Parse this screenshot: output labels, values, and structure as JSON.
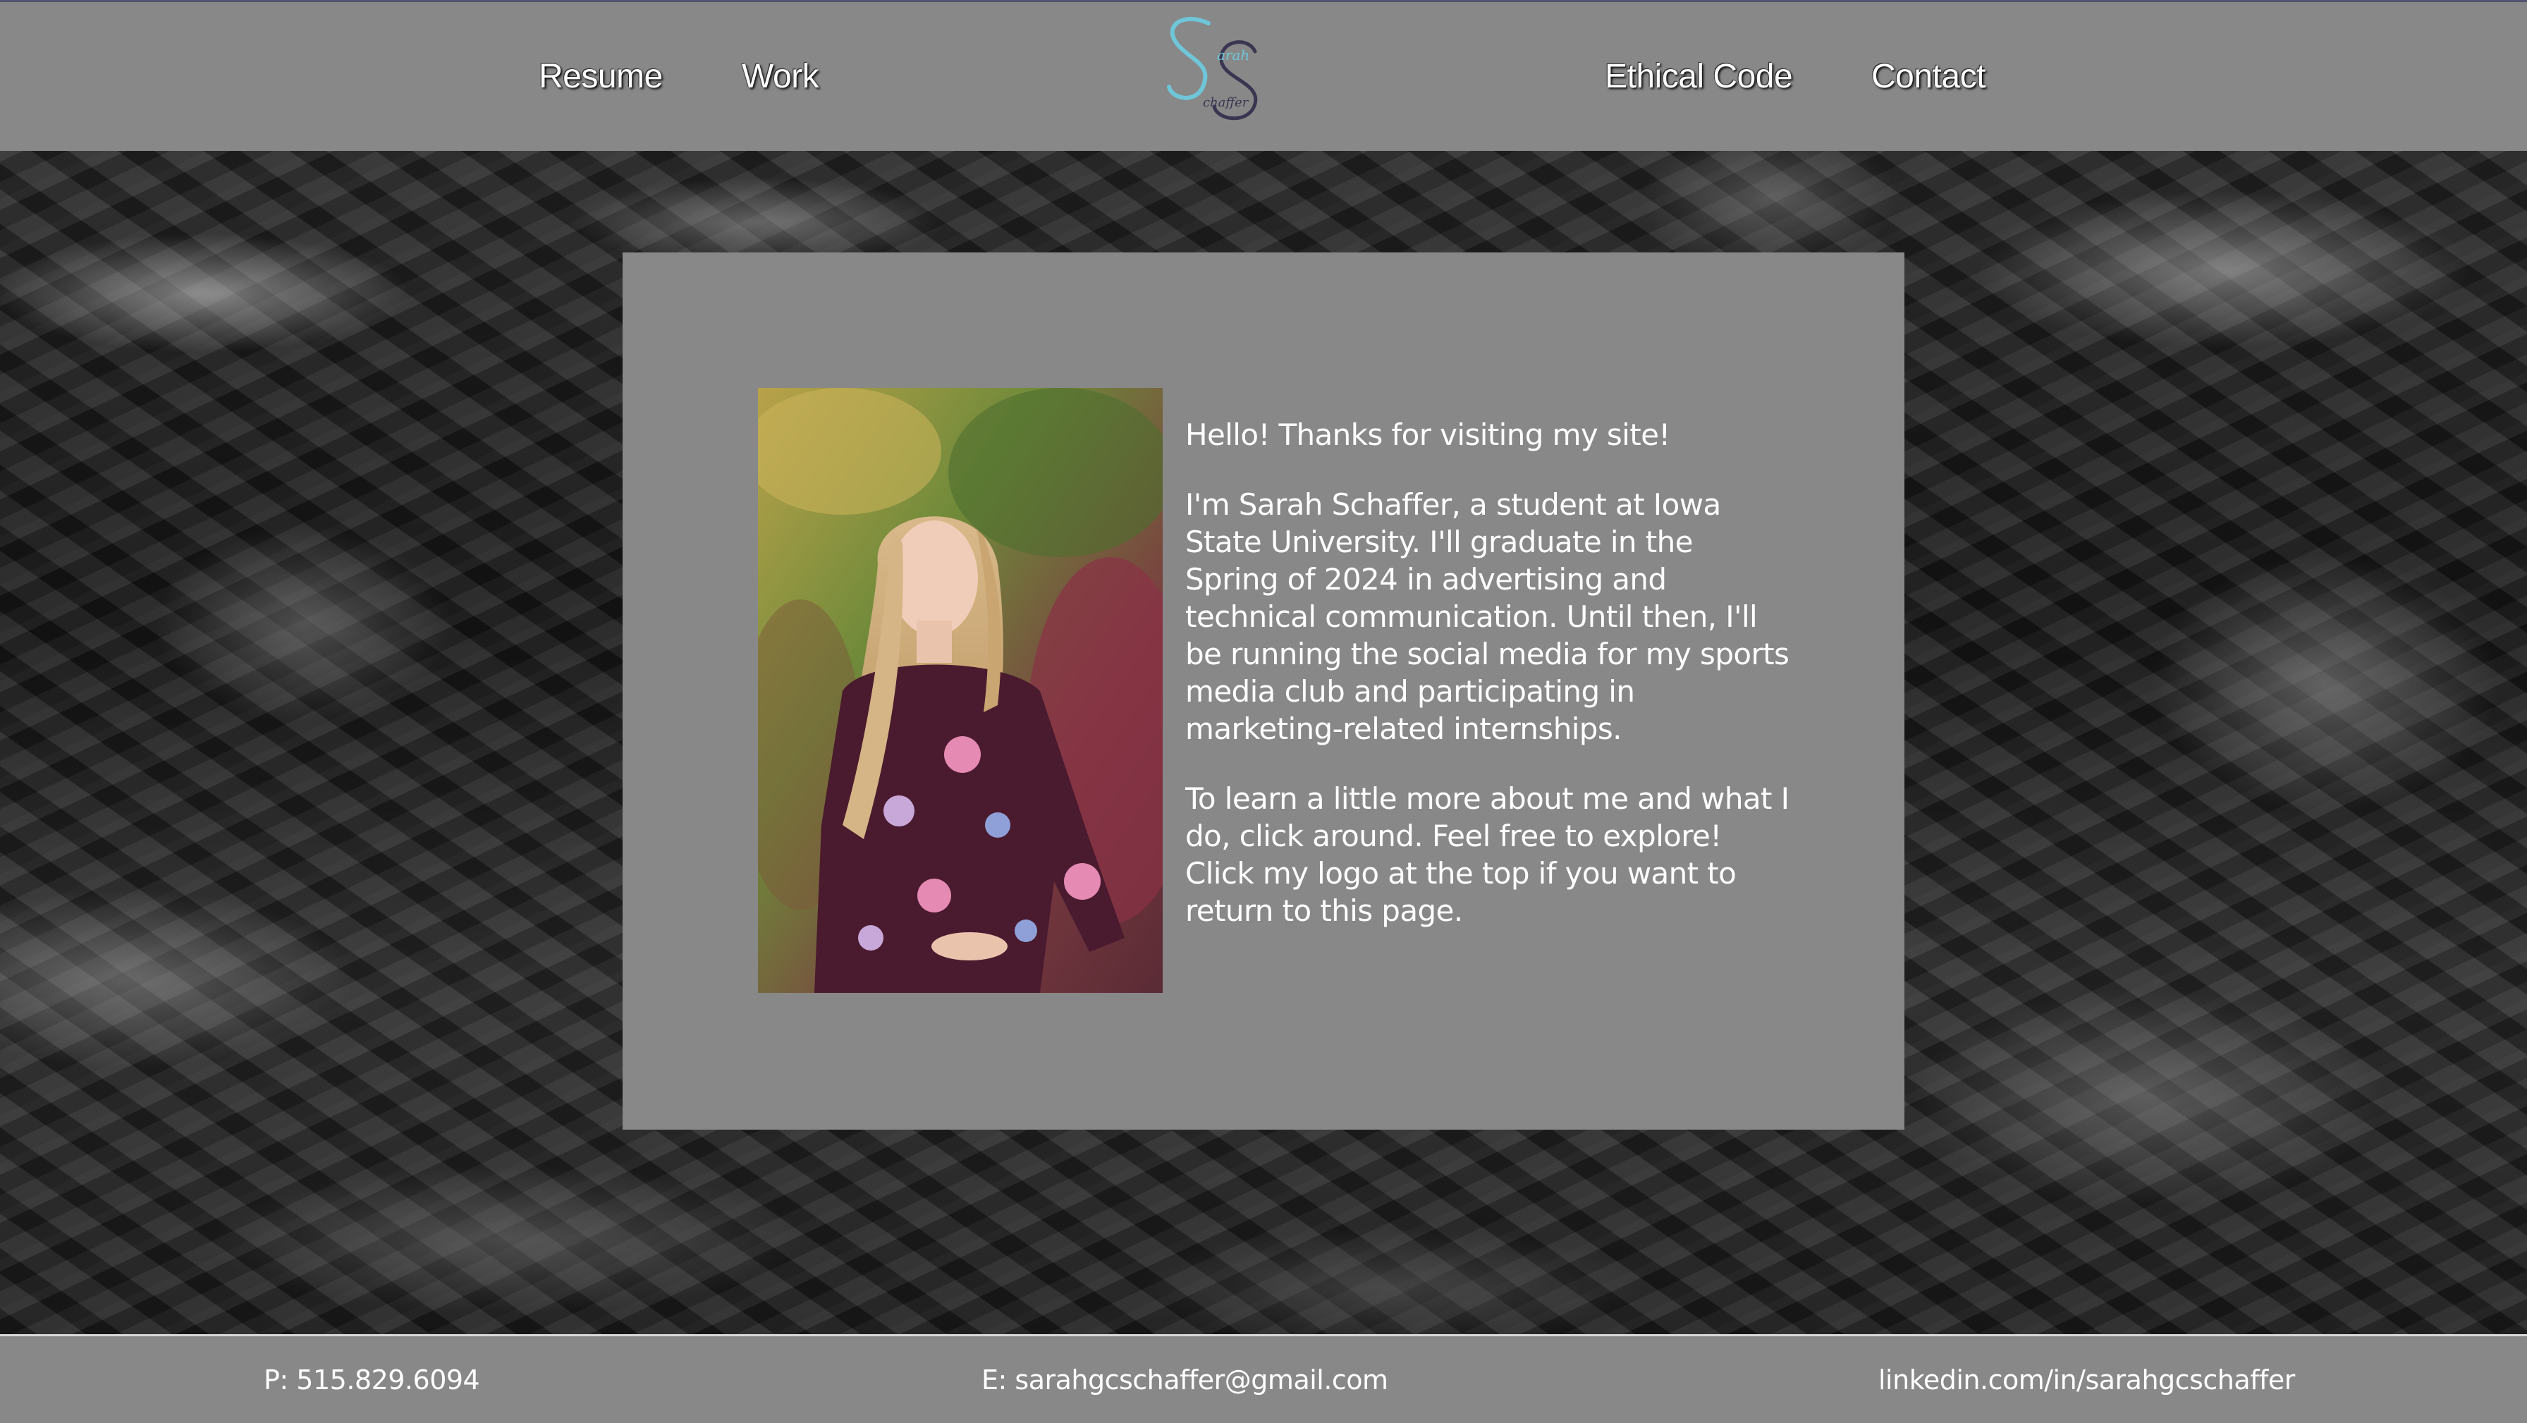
{
  "header": {
    "nav_left": [
      "Resume",
      "Work"
    ],
    "nav_right": [
      "Ethical Code",
      "Contact"
    ],
    "logo": {
      "icon": "ss-monogram-logo",
      "text_top": "arah",
      "text_bottom": "chaffer"
    }
  },
  "main": {
    "greeting": "Hello! Thanks for visiting my site!",
    "paragraph_1": "I'm Sarah Schaffer, a student at Iowa State University. I'll graduate in the Spring of 2024 in advertising and technical communication. Until then, I'll be running the social media for my sports media club and participating in marketing-related internships.",
    "paragraph_2": "To learn a little more about me and what I do, click around. Feel free to explore! Click my logo at the top if you want to return to this page."
  },
  "footer": {
    "phone": "P: 515.829.6094",
    "email": "E: sarahgcschaffer@gmail.com",
    "linkedin": "linkedin.com/in/sarahgcschaffer"
  },
  "colors": {
    "panel": "#888888",
    "logo_accent": "#6ec6d8",
    "logo_dark": "#3a3550"
  }
}
